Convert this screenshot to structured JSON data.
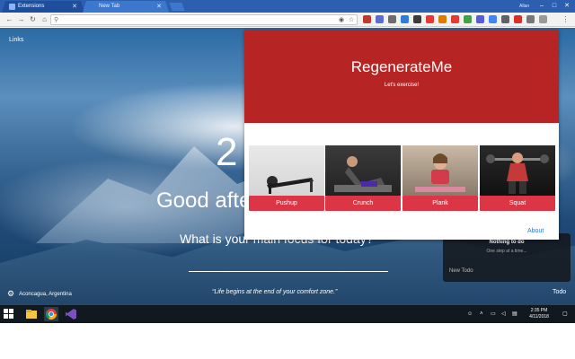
{
  "browser": {
    "tabs": [
      {
        "title": "Extensions"
      },
      {
        "title": "New Tab"
      }
    ],
    "user": "Allan",
    "address": ""
  },
  "newtab": {
    "links_label": "Links",
    "clock": "2",
    "greeting": "Good afte",
    "focus_question": "What is your main focus for today?",
    "location": "Aconcagua, Argentina",
    "quote": "“Life begins at the end of your comfort zone.”",
    "todo_label": "Todo"
  },
  "todo_panel": {
    "empty_title": "Nothing to do",
    "empty_sub": "One step at a time...",
    "new_todo_placeholder": "New Todo"
  },
  "popup": {
    "title": "RegenerateMe",
    "subtitle": "Let's exercise!",
    "exercises": [
      {
        "label": "Pushup"
      },
      {
        "label": "Crunch"
      },
      {
        "label": "Plank"
      },
      {
        "label": "Squat"
      }
    ],
    "about_link": "About",
    "accent_color": "#b72424",
    "button_color": "#dc3545"
  },
  "taskbar": {
    "time": "2:35 PM",
    "date": "4/11/2018"
  }
}
